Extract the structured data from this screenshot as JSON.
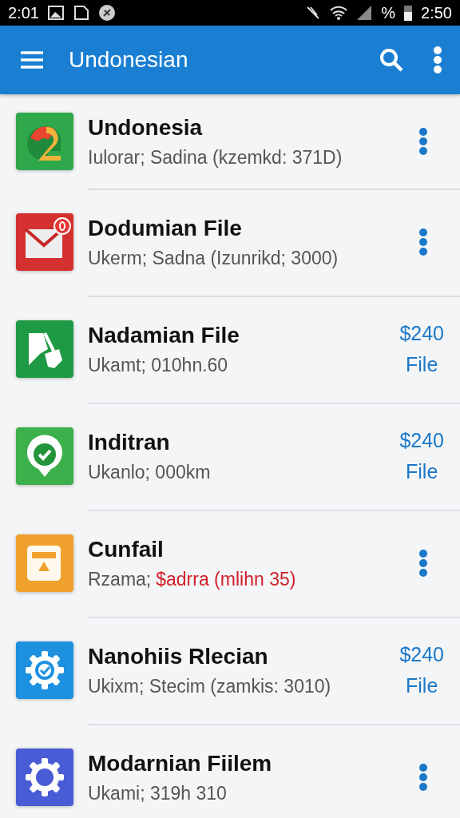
{
  "status_bar": {
    "time_left": "2:01",
    "battery_percent": "%",
    "time_right": "2:50"
  },
  "app_bar": {
    "title": "Undonesian"
  },
  "items": [
    {
      "title": "Undonesia",
      "subtitle": "Iulorar; Sadina (kzemkd: 371D)",
      "trailing": {
        "kind": "menu"
      }
    },
    {
      "title": "Dodumian File",
      "subtitle": "Ukerm; Sadna (Izunrikd; 3000)",
      "trailing": {
        "kind": "menu"
      }
    },
    {
      "title": "Nadamian File",
      "subtitle": "Ukamt; 010hn.60",
      "trailing": {
        "kind": "price",
        "price": "$240",
        "label": "File"
      }
    },
    {
      "title": "Inditran",
      "subtitle": "Ukanlo; 000km",
      "trailing": {
        "kind": "price",
        "price": "$240",
        "label": "File"
      }
    },
    {
      "title": "Cunfail",
      "subtitle": "Rzama;",
      "alert": "$adrra (mlihn 35)",
      "trailing": {
        "kind": "menu"
      }
    },
    {
      "title": "Nanohiis Rlecian",
      "subtitle": "Ukixm; Stecim (zamkis: 3010)",
      "trailing": {
        "kind": "price",
        "price": "$240",
        "label": "File"
      }
    },
    {
      "title": "Modarnian Fiilem",
      "subtitle": "Ukami; 319h 310",
      "trailing": {
        "kind": "menu"
      }
    }
  ]
}
